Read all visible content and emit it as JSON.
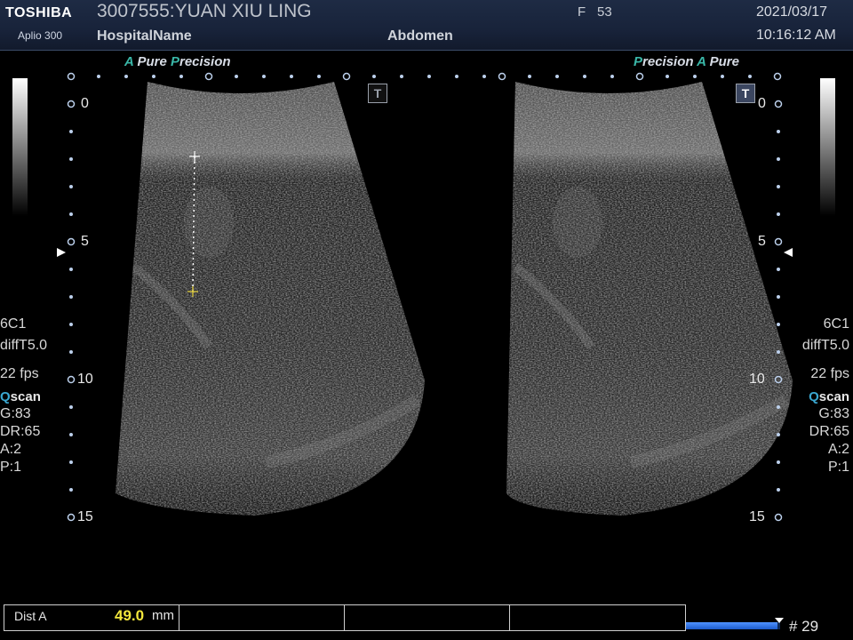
{
  "header": {
    "brand": "TOSHIBA",
    "model": "Aplio 300",
    "patient": "3007555:YUAN XIU LING",
    "hospital": "HospitalName",
    "sex": "F",
    "age": "53",
    "exam": "Abdomen",
    "date": "2021/03/17",
    "time": "10:16:12 AM"
  },
  "left_image": {
    "algo_a1": "A",
    "algo_pure": "Pure",
    "algo_p": "P",
    "algo_precision": "recision",
    "depth_labels": [
      "0",
      "5",
      "10",
      "15"
    ],
    "params": {
      "probe": "6C1",
      "mode": "diffT5.0",
      "fps": "22 fps",
      "qscan_q": "Q",
      "qscan_rest": "scan",
      "gain": "G:83",
      "dr": "DR:65",
      "a": "A:2",
      "p": "P:1"
    },
    "t_marker": "T"
  },
  "right_image": {
    "algo_precision": "Precision",
    "algo_a": "A",
    "algo_pure": "Pure",
    "depth_labels": [
      "0",
      "5",
      "10",
      "15"
    ],
    "params": {
      "probe": "6C1",
      "mode": "diffT5.0",
      "fps": "22 fps",
      "qscan_q": "Q",
      "qscan_rest": "scan",
      "gain": "G:83",
      "dr": "DR:65",
      "a": "A:2",
      "p": "P:1"
    },
    "t_marker": "T"
  },
  "measurement": {
    "label": "Dist A",
    "value": "49.0",
    "unit": "mm"
  },
  "cine": {
    "frame_label": "# 29",
    "progress": 0.97
  },
  "colors": {
    "header_bg": "#18233a",
    "measurement_value": "#f2e63c",
    "progress_fill": "#3574e6",
    "algo_accent": "#3ab7a8"
  }
}
